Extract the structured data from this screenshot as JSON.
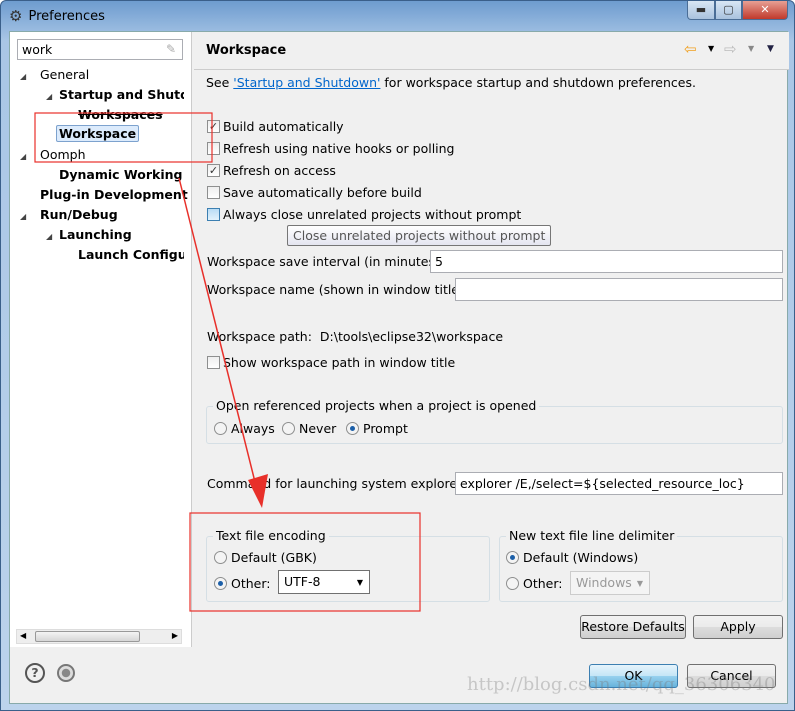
{
  "window": {
    "title": "Preferences",
    "controls": [
      "minimize",
      "maximize",
      "close"
    ]
  },
  "sidebar": {
    "filter_value": "work",
    "tree": [
      {
        "label": "General",
        "bold": false,
        "expanded": true
      },
      {
        "label": "Startup and Shutdown",
        "bold": true,
        "expanded": true
      },
      {
        "label": "Workspaces",
        "bold": true,
        "strikethrough": true
      },
      {
        "label": "Workspace",
        "bold": true,
        "selected": true
      },
      {
        "label": "Oomph",
        "bold": false,
        "expanded": true
      },
      {
        "label": "Dynamic Working Sets",
        "bold": true
      },
      {
        "label": "Plug-in Development",
        "bold": true
      },
      {
        "label": "Run/Debug",
        "bold": true,
        "expanded": true
      },
      {
        "label": "Launching",
        "bold": true,
        "expanded": true
      },
      {
        "label": "Launch Configurations",
        "bold": true
      }
    ]
  },
  "page": {
    "title": "Workspace",
    "see_prefix": "See ",
    "see_link": "'Startup and Shutdown'",
    "see_suffix": " for workspace startup and shutdown preferences.",
    "checkboxes": [
      {
        "label": "Build automatically",
        "checked": true
      },
      {
        "label": "Refresh using native hooks or polling",
        "checked": false
      },
      {
        "label": "Refresh on access",
        "checked": true
      },
      {
        "label": "Save automatically before build",
        "checked": false
      },
      {
        "label": "Always close unrelated projects without prompt",
        "checked": false
      }
    ],
    "tooltip": "Close unrelated projects without prompt",
    "save_interval_label": "Workspace save interval (in minutes):",
    "save_interval_value": "5",
    "name_label": "Workspace name (shown in window title):",
    "name_value": "",
    "path_label": "Workspace path:",
    "path_value": "D:\\tools\\eclipse32\\workspace",
    "show_path_label": "Show workspace path in window title",
    "show_path_checked": false,
    "open_ref": {
      "label": "Open referenced projects when a project is opened",
      "options": [
        "Always",
        "Never",
        "Prompt"
      ],
      "selected": "Prompt"
    },
    "explorer_label": "Command for launching system explorer:",
    "explorer_value": "explorer /E,/select=${selected_resource_loc}",
    "encoding": {
      "label": "Text file encoding",
      "default_label": "Default (GBK)",
      "other_label": "Other:",
      "selected": "Other",
      "other_value": "UTF-8"
    },
    "delimiter": {
      "label": "New text file line delimiter",
      "default_label": "Default (Windows)",
      "other_label": "Other:",
      "selected": "Default",
      "other_value": "Windows"
    },
    "restore_defaults": "Restore Defaults",
    "apply": "Apply"
  },
  "footer": {
    "ok": "OK",
    "cancel": "Cancel",
    "help_icon": "question-icon",
    "import_icon": "circle-icon"
  },
  "watermark": "http://blog.csdn.net/qq_36306340",
  "annotation_color": "#e8302a"
}
